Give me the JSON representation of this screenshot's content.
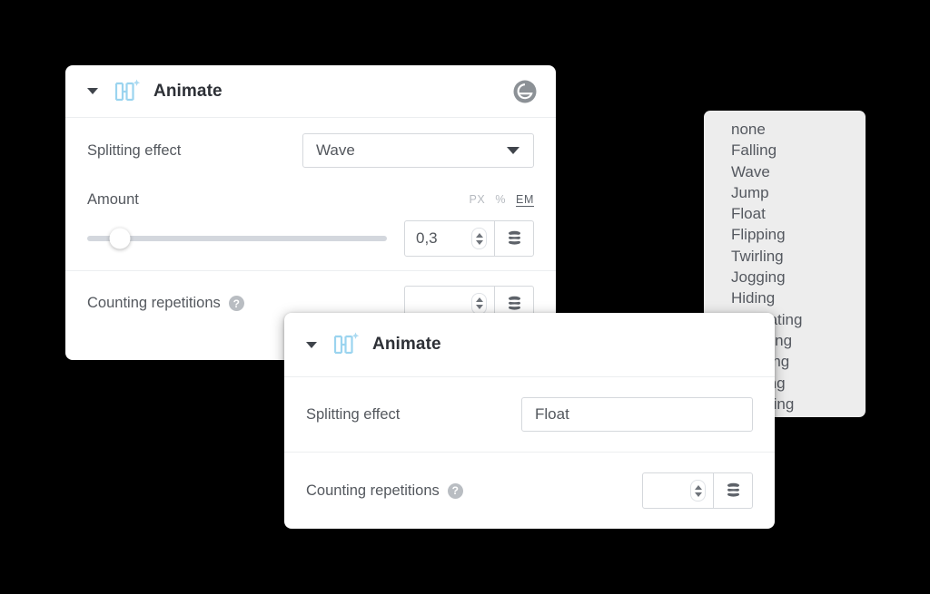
{
  "background_color": "#000000",
  "panels": [
    {
      "id": "panel-primary",
      "header": {
        "title": "Animate",
        "collapse_icon": "chevron-down-icon",
        "brand_icon": "happy-addons-icon",
        "logo_icon": "elementor-logo-icon"
      },
      "splitting_effect": {
        "label": "Splitting effect",
        "value": "Wave",
        "caret_icon": "chevron-down-icon"
      },
      "amount": {
        "label": "Amount",
        "units": [
          {
            "label": "PX",
            "active": false
          },
          {
            "label": "%",
            "active": false
          },
          {
            "label": "EM",
            "active": true
          }
        ],
        "slider_percent": 11,
        "value": "0,3",
        "stepper_icon": "spinner-updown-icon",
        "db_icon": "database-stack-icon"
      },
      "counting_repetitions": {
        "label": "Counting repetitions",
        "help_icon": "question-mark-icon",
        "help_glyph": "?",
        "value": "",
        "stepper_icon": "spinner-updown-icon",
        "db_icon": "database-stack-icon"
      }
    },
    {
      "id": "panel-secondary",
      "header": {
        "title": "Animate",
        "collapse_icon": "chevron-down-icon",
        "brand_icon": "happy-addons-icon"
      },
      "splitting_effect": {
        "label": "Splitting effect",
        "value": "Float"
      },
      "counting_repetitions": {
        "label": "Counting repetitions",
        "help_icon": "question-mark-icon",
        "help_glyph": "?",
        "value": "",
        "stepper_icon": "spinner-updown-icon",
        "db_icon": "database-stack-icon"
      }
    }
  ],
  "dropdown": {
    "name": "splitting-effect-options",
    "options": [
      "none",
      "Falling",
      "Wave",
      "Jump",
      "Float",
      "Flipping",
      "Twirling",
      "Jogging",
      "Hiding",
      "Retreating",
      "Breaking",
      "Swaying",
      "Blinking",
      "Tumbling"
    ]
  },
  "colors": {
    "panel_background": "#ffffff",
    "dropdown_background": "#ededed",
    "label_text": "#54585e",
    "title_text": "#2d3036",
    "border": "#d5d8dc",
    "divider": "#eceef0",
    "slider_track": "#d3d7dd",
    "brand_icon": "#9bd4ef",
    "logo_gray": "#8c9196"
  }
}
